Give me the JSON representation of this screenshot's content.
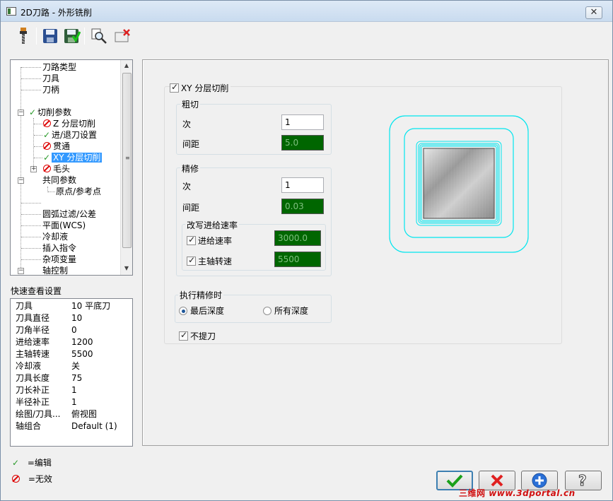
{
  "window": {
    "title": "2D刀路 - 外形铣削",
    "close_symbol": "✕"
  },
  "toolbar": {
    "icons": [
      "tool-icon",
      "save-icon",
      "save-green-icon",
      "magnify-icon",
      "delete-icon"
    ]
  },
  "tree": {
    "items": [
      {
        "label": "刀路类型",
        "status": "none"
      },
      {
        "label": "刀具",
        "status": "none"
      },
      {
        "label": "刀柄",
        "status": "none"
      },
      {
        "label": "切削参数",
        "status": "edited"
      },
      {
        "label": "Z 分层切削",
        "status": "disabled"
      },
      {
        "label": "进/退刀设置",
        "status": "edited"
      },
      {
        "label": "贯通",
        "status": "disabled"
      },
      {
        "label": "XY 分层切削",
        "status": "edited"
      },
      {
        "label": "毛头",
        "status": "disabled"
      },
      {
        "label": "共同参数",
        "status": "none"
      },
      {
        "label": "原点/参考点",
        "status": "none"
      },
      {
        "label": "",
        "status": "none"
      },
      {
        "label": "圆弧过滤/公差",
        "status": "none"
      },
      {
        "label": "平面(WCS)",
        "status": "none"
      },
      {
        "label": "冷却液",
        "status": "none"
      },
      {
        "label": "插入指令",
        "status": "none"
      },
      {
        "label": "杂项变量",
        "status": "none"
      },
      {
        "label": "轴控制",
        "status": "none"
      }
    ],
    "expander_minus": "−",
    "expander_plus": "+",
    "scroll_up": "▲",
    "scroll_down": "▼",
    "grip": "≡"
  },
  "quickview": {
    "label": "快速查看设置",
    "rows": [
      {
        "k": "刀具",
        "v": "10 平底刀"
      },
      {
        "k": "刀具直径",
        "v": "10"
      },
      {
        "k": "刀角半径",
        "v": "0"
      },
      {
        "k": "进给速率",
        "v": "1200"
      },
      {
        "k": "主轴转速",
        "v": "5500"
      },
      {
        "k": "冷却液",
        "v": "关"
      },
      {
        "k": "刀具长度",
        "v": "75"
      },
      {
        "k": "刀长补正",
        "v": "1"
      },
      {
        "k": "半径补正",
        "v": "1"
      },
      {
        "k": "绘图/刀具...",
        "v": "俯视图"
      },
      {
        "k": "轴组合",
        "v": "Default (1)"
      }
    ]
  },
  "legend": {
    "edited": "=编辑",
    "disabled": "=无效"
  },
  "params": {
    "xy_layer_label": "XY 分层切削",
    "xy_layer_checked": true,
    "rough": {
      "title": "粗切",
      "count_label": "次",
      "count_value": "1",
      "spacing_label": "间距",
      "spacing_value": "5.0"
    },
    "finish": {
      "title": "精修",
      "count_label": "次",
      "count_value": "1",
      "spacing_label": "间距",
      "spacing_value": "0.03"
    },
    "override": {
      "title": "改写进给速率",
      "feed_label": "进给速率",
      "feed_checked": true,
      "feed_value": "3000.0",
      "spindle_label": "主轴转速",
      "spindle_checked": true,
      "spindle_value": "5500"
    },
    "exec_finish": {
      "title": "执行精修时",
      "option_last": "最后深度",
      "option_all": "所有深度",
      "selected": "last"
    },
    "no_lift_label": "不提刀",
    "no_lift_checked": true
  },
  "buttons": {
    "ok_icon": "check-icon",
    "cancel_icon": "cross-icon",
    "add_icon": "plus-icon",
    "help_icon": "question-icon"
  },
  "colors": {
    "edited_check": "#2a9a2a",
    "disabled_icon": "#d00000",
    "green_field": "#006600",
    "preview_cyan": "#00e5ee"
  },
  "watermark": {
    "text1": "三维网",
    "text2": "www.3dportal.cn"
  }
}
